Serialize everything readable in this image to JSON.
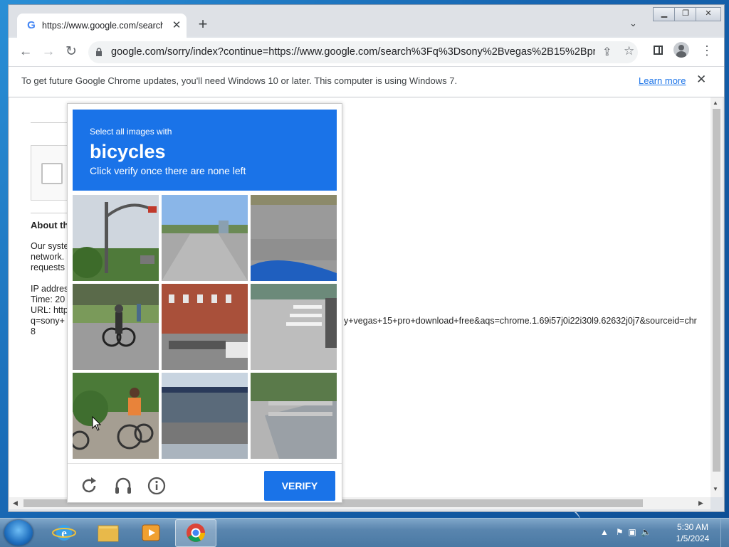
{
  "browser": {
    "tab_title": "https://www.google.com/search?",
    "tab_favicon": "google-g-icon",
    "url": "google.com/sorry/index?continue=https://www.google.com/search%3Fq%3Dsony%2Bvegas%2B15%2Bpro...",
    "window_controls": [
      "minimize",
      "maximize",
      "close"
    ]
  },
  "infobar": {
    "message": "To get future Google Chrome updates, you'll need Windows 10 or later. This computer is using Windows 7.",
    "learn_more": "Learn more"
  },
  "page": {
    "about_heading": "About th",
    "para_line1": "Our syste",
    "para_line2": "network.",
    "para_line3": "requests",
    "ip_line": "IP addres",
    "time_line": "Time: 20",
    "url_line": "URL: http",
    "q_line": "q=sony+",
    "url_tail": "y+vegas+15+pro+download+free&aqs=chrome.1.69i57j0i22i30l9.62632j0j7&sourceid=chr",
    "num_line": "8"
  },
  "captcha": {
    "instruction": "Select all images with",
    "target": "bicycles",
    "sub_instruction": "Click verify once there are none left",
    "verify_label": "VERIFY",
    "colors": {
      "header_bg": "#1a73e8",
      "verify_bg": "#1a73e8"
    },
    "tiles": [
      "street-lamp-traffic-light",
      "empty-road",
      "road-asphalt-blue-vehicle",
      "cyclist-on-sidewalk",
      "brick-building-trailer",
      "crosswalk-car",
      "cyclists-child-orange-shirt",
      "bus-shelter",
      "pickup-truck"
    ]
  },
  "taskbar": {
    "pinned": [
      "internet-explorer-icon",
      "file-explorer-icon",
      "media-player-icon",
      "chrome-icon"
    ],
    "time": "5:30 AM",
    "date": "1/5/2024"
  }
}
